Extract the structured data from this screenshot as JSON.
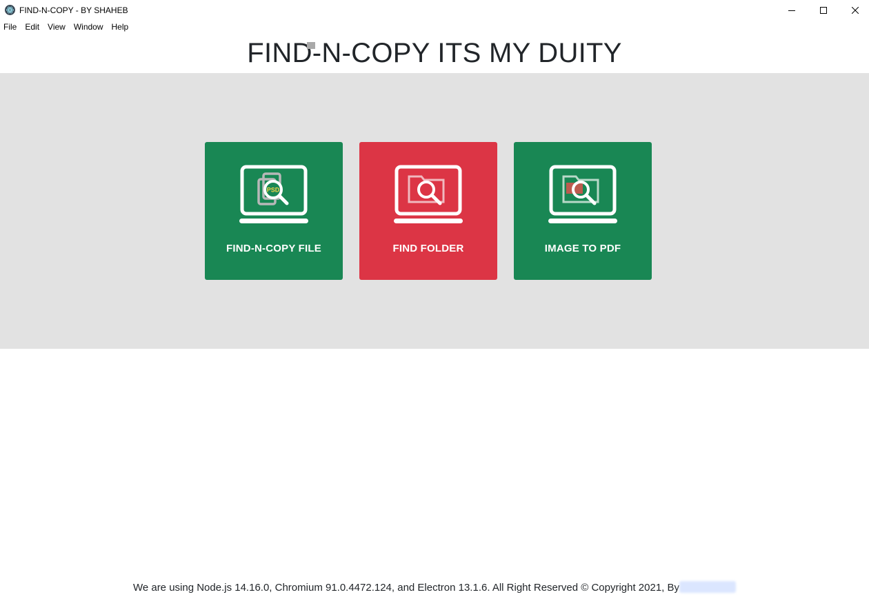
{
  "window": {
    "title": "FIND-N-COPY - BY SHAHEB",
    "icon": "electron-app-icon"
  },
  "menu": {
    "items": [
      {
        "label": "File"
      },
      {
        "label": "Edit"
      },
      {
        "label": "View"
      },
      {
        "label": "Window"
      },
      {
        "label": "Help"
      }
    ]
  },
  "page": {
    "title": "FIND-N-COPY ITS MY DUITY"
  },
  "tiles": [
    {
      "label": "FIND-N-COPY FILE",
      "color": "#198754",
      "icon": "laptop-file-search-icon",
      "badge": "PSD"
    },
    {
      "label": "FIND FOLDER",
      "color": "#dc3545",
      "icon": "laptop-folder-search-icon"
    },
    {
      "label": "IMAGE TO PDF",
      "color": "#198754",
      "icon": "laptop-image-pdf-search-icon"
    }
  ],
  "footer": {
    "text": "We are using Node.js 14.16.0, Chromium 91.0.4472.124, and Electron 13.1.6. All Right Reserved © Copyright 2021, By"
  },
  "colors": {
    "band": "#e2e2e2",
    "green": "#198754",
    "red": "#dc3545"
  }
}
